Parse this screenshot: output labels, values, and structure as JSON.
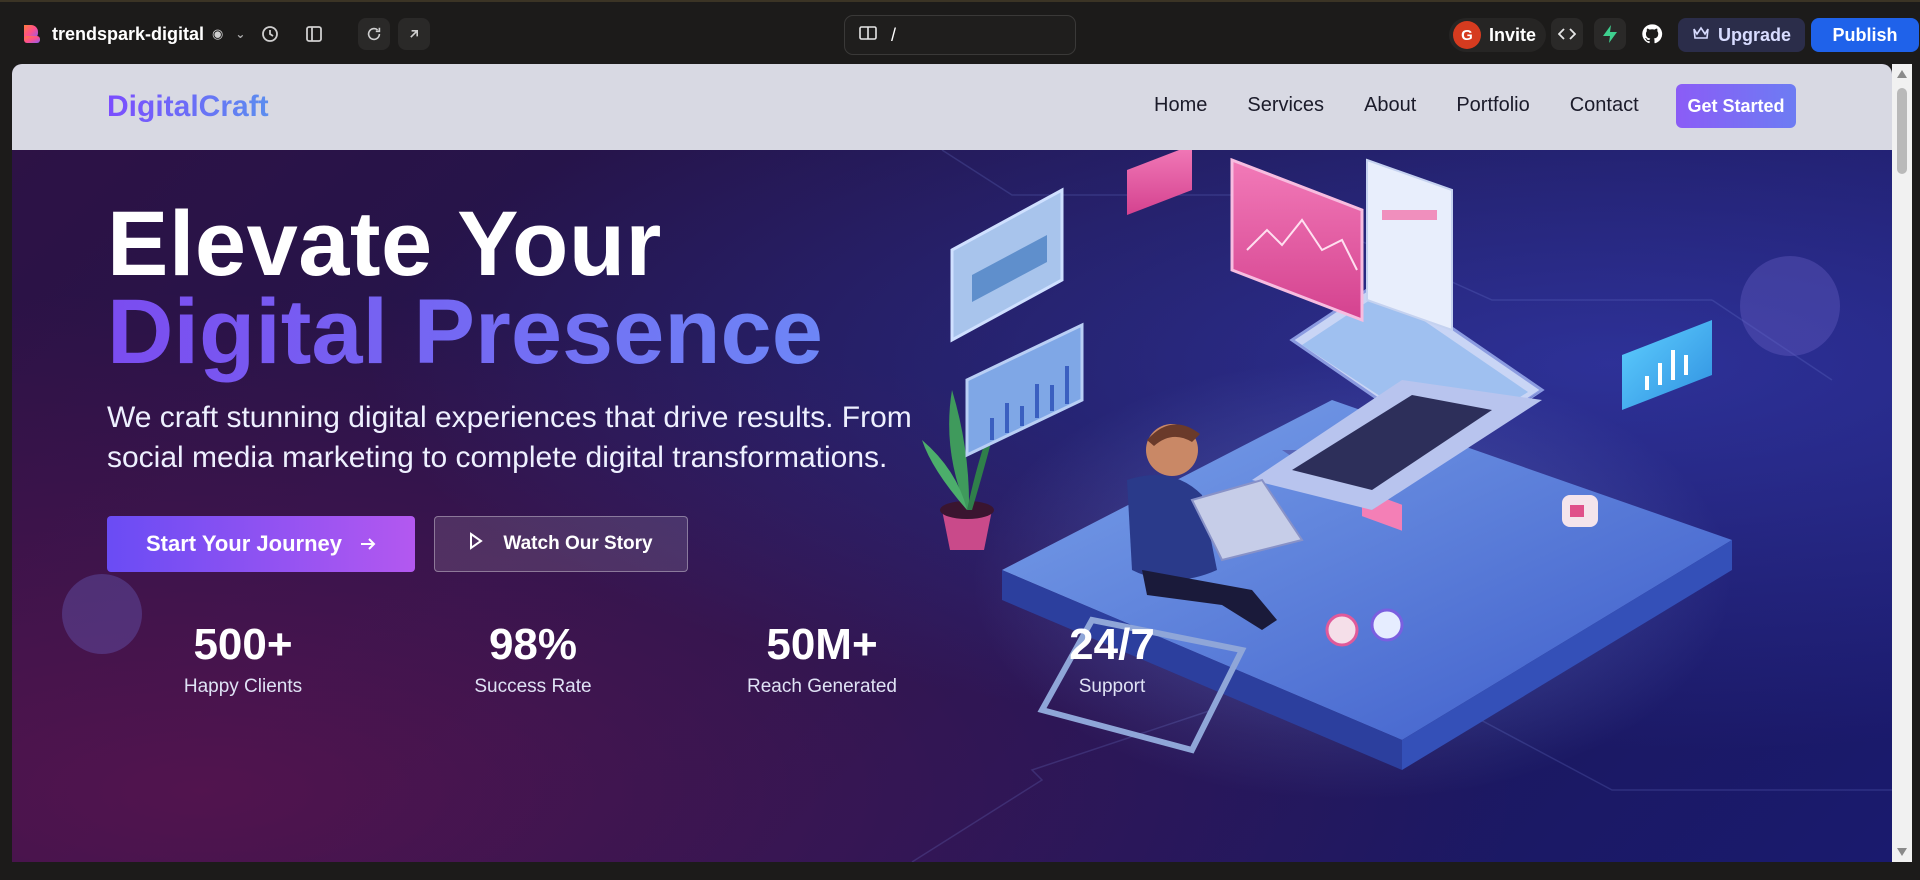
{
  "editor": {
    "project_name": "trendspark-digital",
    "url_path": "/",
    "avatar_initial": "G",
    "invite_label": "Invite",
    "upgrade_label": "Upgrade",
    "publish_label": "Publish",
    "colors": {
      "publish": "#1f62ea",
      "avatar": "#d63b1f"
    }
  },
  "site": {
    "brand": "DigitalCraft",
    "nav": [
      "Home",
      "Services",
      "About",
      "Portfolio",
      "Contact"
    ],
    "cta": "Get Started",
    "hero": {
      "title_line1": "Elevate Your",
      "title_line2": "Digital Presence",
      "subtitle": "We craft stunning digital experiences that drive results. From social media marketing to complete digital transformations.",
      "primary_button": "Start Your Journey",
      "secondary_button": "Watch Our Story"
    },
    "stats": [
      {
        "value": "500+",
        "label": "Happy Clients"
      },
      {
        "value": "98%",
        "label": "Success Rate"
      },
      {
        "value": "50M+",
        "label": "Reach Generated"
      },
      {
        "value": "24/7",
        "label": "Support"
      }
    ]
  }
}
